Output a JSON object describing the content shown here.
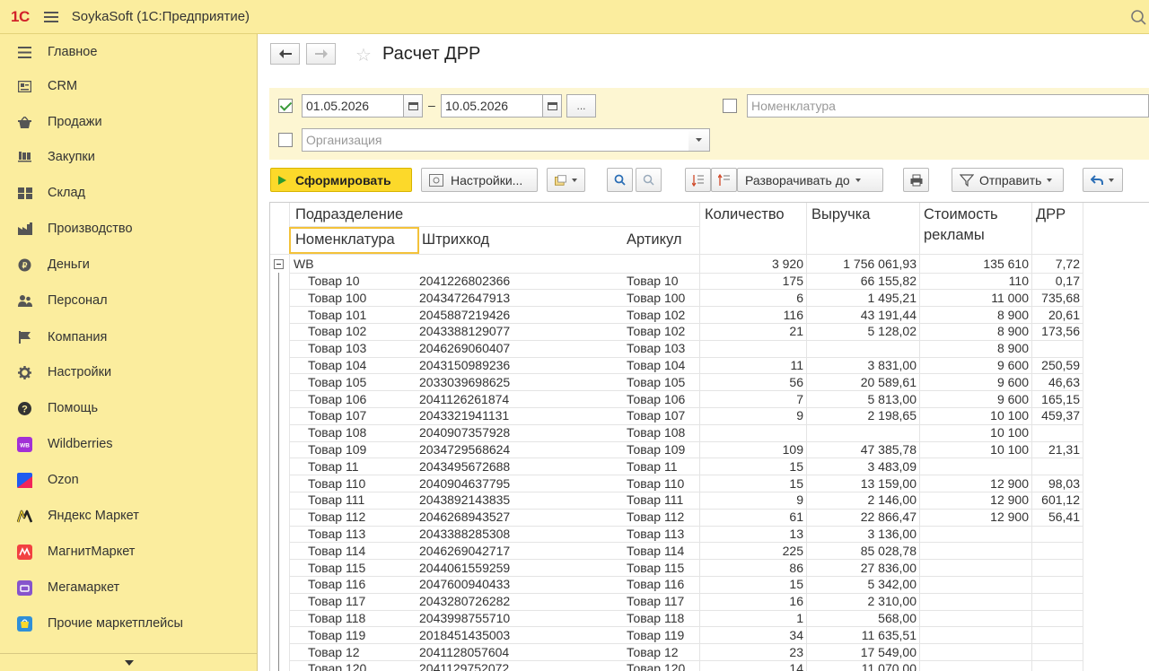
{
  "app": {
    "logo": "1С",
    "title": "SoykaSoft  (1С:Предприятие)"
  },
  "sidebar": {
    "items": [
      {
        "label": "Главное",
        "icon": "menu-lines-icon"
      },
      {
        "label": "CRM",
        "icon": "contact-card-icon"
      },
      {
        "label": "Продажи",
        "icon": "basket-icon"
      },
      {
        "label": "Закупки",
        "icon": "cart-icon"
      },
      {
        "label": "Склад",
        "icon": "warehouse-icon"
      },
      {
        "label": "Производство",
        "icon": "factory-icon"
      },
      {
        "label": "Деньги",
        "icon": "coin-icon"
      },
      {
        "label": "Персонал",
        "icon": "people-icon"
      },
      {
        "label": "Компания",
        "icon": "flag-icon"
      },
      {
        "label": "Настройки",
        "icon": "gear-icon"
      },
      {
        "label": "Помощь",
        "icon": "help-icon"
      },
      {
        "label": "Wildberries",
        "icon": "wildberries-logo-icon",
        "color": "#a230d6",
        "badge": "WB"
      },
      {
        "label": "Ozon",
        "icon": "ozon-logo-icon",
        "color": "#1f5cf0"
      },
      {
        "label": "Яндекс Маркет",
        "icon": "yandex-market-logo-icon",
        "color": "#fc3f1d"
      },
      {
        "label": "МагнитМаркет",
        "icon": "magnit-market-logo-icon",
        "color": "#f24141"
      },
      {
        "label": "Мегамаркет",
        "icon": "megamarket-logo-icon",
        "color": "#8654cc"
      },
      {
        "label": "Прочие маркетплейсы",
        "icon": "other-marketplaces-icon",
        "color": "#2f8fd8"
      }
    ]
  },
  "page": {
    "title": "Расчет ДРР"
  },
  "filters": {
    "period_enabled": true,
    "date_from": "01.05.2026",
    "date_to": "10.05.2026",
    "period_dash": "–",
    "period_more": "...",
    "nomenclature_placeholder": "Номенклатура",
    "organization_placeholder": "Организация"
  },
  "toolbar": {
    "generate": "Сформировать",
    "settings": "Настройки...",
    "expand_to": "Разворачивать до",
    "send": "Отправить"
  },
  "report": {
    "headers": {
      "subdivision": "Подразделение",
      "nomenclature": "Номенклатура",
      "barcode": "Штрихкод",
      "article": "Артикул",
      "quantity": "Количество",
      "revenue": "Выручка",
      "ad_cost_line1": "Стоимость",
      "ad_cost_line2": "рекламы",
      "drr": "ДРР"
    },
    "group": {
      "name": "WB",
      "quantity": "3 920",
      "revenue": "1 756 061,93",
      "ad_cost": "135 610",
      "drr": "7,72"
    },
    "rows": [
      {
        "name": "Товар 10",
        "barcode": "2041226802366",
        "article": "Товар 10",
        "qty": "175",
        "revenue": "66 155,82",
        "ad": "110",
        "drr": "0,17"
      },
      {
        "name": "Товар 100",
        "barcode": "2043472647913",
        "article": "Товар 100",
        "qty": "6",
        "revenue": "1 495,21",
        "ad": "11 000",
        "drr": "735,68"
      },
      {
        "name": "Товар 101",
        "barcode": "2045887219426",
        "article": "Товар 102",
        "qty": "116",
        "revenue": "43 191,44",
        "ad": "8 900",
        "drr": "20,61"
      },
      {
        "name": "Товар 102",
        "barcode": "2043388129077",
        "article": "Товар 102",
        "qty": "21",
        "revenue": "5 128,02",
        "ad": "8 900",
        "drr": "173,56"
      },
      {
        "name": "Товар 103",
        "barcode": "2046269060407",
        "article": "Товар 103",
        "qty": "",
        "revenue": "",
        "ad": "8 900",
        "drr": ""
      },
      {
        "name": "Товар 104",
        "barcode": "2043150989236",
        "article": "Товар 104",
        "qty": "11",
        "revenue": "3 831,00",
        "ad": "9 600",
        "drr": "250,59"
      },
      {
        "name": "Товар 105",
        "barcode": "2033039698625",
        "article": "Товар 105",
        "qty": "56",
        "revenue": "20 589,61",
        "ad": "9 600",
        "drr": "46,63"
      },
      {
        "name": "Товар 106",
        "barcode": "2041126261874",
        "article": "Товар 106",
        "qty": "7",
        "revenue": "5 813,00",
        "ad": "9 600",
        "drr": "165,15"
      },
      {
        "name": "Товар 107",
        "barcode": "2043321941131",
        "article": "Товар 107",
        "qty": "9",
        "revenue": "2 198,65",
        "ad": "10 100",
        "drr": "459,37"
      },
      {
        "name": "Товар 108",
        "barcode": "2040907357928",
        "article": "Товар 108",
        "qty": "",
        "revenue": "",
        "ad": "10 100",
        "drr": ""
      },
      {
        "name": "Товар 109",
        "barcode": "2034729568624",
        "article": "Товар 109",
        "qty": "109",
        "revenue": "47 385,78",
        "ad": "10 100",
        "drr": "21,31"
      },
      {
        "name": "Товар 11",
        "barcode": "2043495672688",
        "article": "Товар 11",
        "qty": "15",
        "revenue": "3 483,09",
        "ad": "",
        "drr": ""
      },
      {
        "name": "Товар 110",
        "barcode": "2040904637795",
        "article": "Товар 110",
        "qty": "15",
        "revenue": "13 159,00",
        "ad": "12 900",
        "drr": "98,03"
      },
      {
        "name": "Товар 111",
        "barcode": "2043892143835",
        "article": "Товар 111",
        "qty": "9",
        "revenue": "2 146,00",
        "ad": "12 900",
        "drr": "601,12"
      },
      {
        "name": "Товар 112",
        "barcode": "2046268943527",
        "article": "Товар 112",
        "qty": "61",
        "revenue": "22 866,47",
        "ad": "12 900",
        "drr": "56,41"
      },
      {
        "name": "Товар 113",
        "barcode": "2043388285308",
        "article": "Товар 113",
        "qty": "13",
        "revenue": "3 136,00",
        "ad": "",
        "drr": ""
      },
      {
        "name": "Товар 114",
        "barcode": "2046269042717",
        "article": "Товар 114",
        "qty": "225",
        "revenue": "85 028,78",
        "ad": "",
        "drr": ""
      },
      {
        "name": "Товар 115",
        "barcode": "2044061559259",
        "article": "Товар 115",
        "qty": "86",
        "revenue": "27 836,00",
        "ad": "",
        "drr": ""
      },
      {
        "name": "Товар 116",
        "barcode": "2047600940433",
        "article": "Товар 116",
        "qty": "15",
        "revenue": "5 342,00",
        "ad": "",
        "drr": ""
      },
      {
        "name": "Товар 117",
        "barcode": "2043280726282",
        "article": "Товар 117",
        "qty": "16",
        "revenue": "2 310,00",
        "ad": "",
        "drr": ""
      },
      {
        "name": "Товар 118",
        "barcode": "2043998755710",
        "article": "Товар 118",
        "qty": "1",
        "revenue": "568,00",
        "ad": "",
        "drr": ""
      },
      {
        "name": "Товар 119",
        "barcode": "2018451435003",
        "article": "Товар 119",
        "qty": "34",
        "revenue": "11 635,51",
        "ad": "",
        "drr": ""
      },
      {
        "name": "Товар 12",
        "barcode": "2041128057604",
        "article": "Товар 12",
        "qty": "23",
        "revenue": "17 549,00",
        "ad": "",
        "drr": ""
      },
      {
        "name": "Товар 120",
        "barcode": "2041129752072",
        "article": "Товар 120",
        "qty": "14",
        "revenue": "11 070,00",
        "ad": "",
        "drr": ""
      }
    ]
  }
}
